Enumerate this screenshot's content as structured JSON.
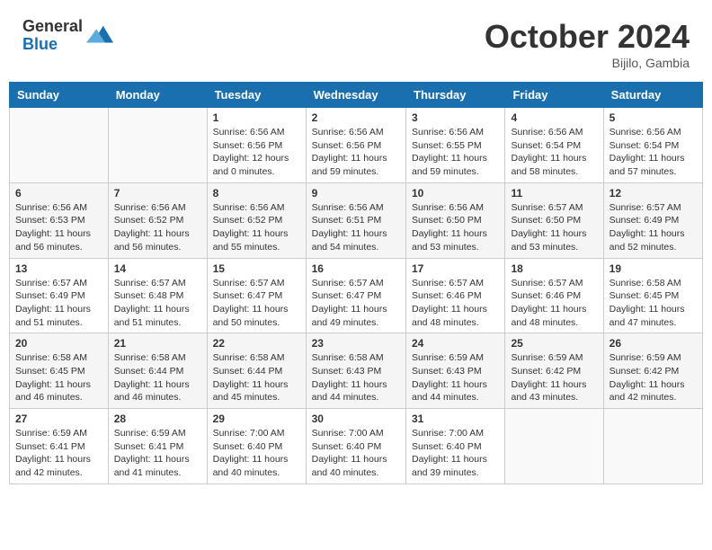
{
  "header": {
    "logo_general": "General",
    "logo_blue": "Blue",
    "month_title": "October 2024",
    "location": "Bijilo, Gambia"
  },
  "days_of_week": [
    "Sunday",
    "Monday",
    "Tuesday",
    "Wednesday",
    "Thursday",
    "Friday",
    "Saturday"
  ],
  "weeks": [
    [
      {
        "day": "",
        "info": ""
      },
      {
        "day": "",
        "info": ""
      },
      {
        "day": "1",
        "sunrise": "Sunrise: 6:56 AM",
        "sunset": "Sunset: 6:56 PM",
        "daylight": "Daylight: 12 hours and 0 minutes."
      },
      {
        "day": "2",
        "sunrise": "Sunrise: 6:56 AM",
        "sunset": "Sunset: 6:56 PM",
        "daylight": "Daylight: 11 hours and 59 minutes."
      },
      {
        "day": "3",
        "sunrise": "Sunrise: 6:56 AM",
        "sunset": "Sunset: 6:55 PM",
        "daylight": "Daylight: 11 hours and 59 minutes."
      },
      {
        "day": "4",
        "sunrise": "Sunrise: 6:56 AM",
        "sunset": "Sunset: 6:54 PM",
        "daylight": "Daylight: 11 hours and 58 minutes."
      },
      {
        "day": "5",
        "sunrise": "Sunrise: 6:56 AM",
        "sunset": "Sunset: 6:54 PM",
        "daylight": "Daylight: 11 hours and 57 minutes."
      }
    ],
    [
      {
        "day": "6",
        "sunrise": "Sunrise: 6:56 AM",
        "sunset": "Sunset: 6:53 PM",
        "daylight": "Daylight: 11 hours and 56 minutes."
      },
      {
        "day": "7",
        "sunrise": "Sunrise: 6:56 AM",
        "sunset": "Sunset: 6:52 PM",
        "daylight": "Daylight: 11 hours and 56 minutes."
      },
      {
        "day": "8",
        "sunrise": "Sunrise: 6:56 AM",
        "sunset": "Sunset: 6:52 PM",
        "daylight": "Daylight: 11 hours and 55 minutes."
      },
      {
        "day": "9",
        "sunrise": "Sunrise: 6:56 AM",
        "sunset": "Sunset: 6:51 PM",
        "daylight": "Daylight: 11 hours and 54 minutes."
      },
      {
        "day": "10",
        "sunrise": "Sunrise: 6:56 AM",
        "sunset": "Sunset: 6:50 PM",
        "daylight": "Daylight: 11 hours and 53 minutes."
      },
      {
        "day": "11",
        "sunrise": "Sunrise: 6:57 AM",
        "sunset": "Sunset: 6:50 PM",
        "daylight": "Daylight: 11 hours and 53 minutes."
      },
      {
        "day": "12",
        "sunrise": "Sunrise: 6:57 AM",
        "sunset": "Sunset: 6:49 PM",
        "daylight": "Daylight: 11 hours and 52 minutes."
      }
    ],
    [
      {
        "day": "13",
        "sunrise": "Sunrise: 6:57 AM",
        "sunset": "Sunset: 6:49 PM",
        "daylight": "Daylight: 11 hours and 51 minutes."
      },
      {
        "day": "14",
        "sunrise": "Sunrise: 6:57 AM",
        "sunset": "Sunset: 6:48 PM",
        "daylight": "Daylight: 11 hours and 51 minutes."
      },
      {
        "day": "15",
        "sunrise": "Sunrise: 6:57 AM",
        "sunset": "Sunset: 6:47 PM",
        "daylight": "Daylight: 11 hours and 50 minutes."
      },
      {
        "day": "16",
        "sunrise": "Sunrise: 6:57 AM",
        "sunset": "Sunset: 6:47 PM",
        "daylight": "Daylight: 11 hours and 49 minutes."
      },
      {
        "day": "17",
        "sunrise": "Sunrise: 6:57 AM",
        "sunset": "Sunset: 6:46 PM",
        "daylight": "Daylight: 11 hours and 48 minutes."
      },
      {
        "day": "18",
        "sunrise": "Sunrise: 6:57 AM",
        "sunset": "Sunset: 6:46 PM",
        "daylight": "Daylight: 11 hours and 48 minutes."
      },
      {
        "day": "19",
        "sunrise": "Sunrise: 6:58 AM",
        "sunset": "Sunset: 6:45 PM",
        "daylight": "Daylight: 11 hours and 47 minutes."
      }
    ],
    [
      {
        "day": "20",
        "sunrise": "Sunrise: 6:58 AM",
        "sunset": "Sunset: 6:45 PM",
        "daylight": "Daylight: 11 hours and 46 minutes."
      },
      {
        "day": "21",
        "sunrise": "Sunrise: 6:58 AM",
        "sunset": "Sunset: 6:44 PM",
        "daylight": "Daylight: 11 hours and 46 minutes."
      },
      {
        "day": "22",
        "sunrise": "Sunrise: 6:58 AM",
        "sunset": "Sunset: 6:44 PM",
        "daylight": "Daylight: 11 hours and 45 minutes."
      },
      {
        "day": "23",
        "sunrise": "Sunrise: 6:58 AM",
        "sunset": "Sunset: 6:43 PM",
        "daylight": "Daylight: 11 hours and 44 minutes."
      },
      {
        "day": "24",
        "sunrise": "Sunrise: 6:59 AM",
        "sunset": "Sunset: 6:43 PM",
        "daylight": "Daylight: 11 hours and 44 minutes."
      },
      {
        "day": "25",
        "sunrise": "Sunrise: 6:59 AM",
        "sunset": "Sunset: 6:42 PM",
        "daylight": "Daylight: 11 hours and 43 minutes."
      },
      {
        "day": "26",
        "sunrise": "Sunrise: 6:59 AM",
        "sunset": "Sunset: 6:42 PM",
        "daylight": "Daylight: 11 hours and 42 minutes."
      }
    ],
    [
      {
        "day": "27",
        "sunrise": "Sunrise: 6:59 AM",
        "sunset": "Sunset: 6:41 PM",
        "daylight": "Daylight: 11 hours and 42 minutes."
      },
      {
        "day": "28",
        "sunrise": "Sunrise: 6:59 AM",
        "sunset": "Sunset: 6:41 PM",
        "daylight": "Daylight: 11 hours and 41 minutes."
      },
      {
        "day": "29",
        "sunrise": "Sunrise: 7:00 AM",
        "sunset": "Sunset: 6:40 PM",
        "daylight": "Daylight: 11 hours and 40 minutes."
      },
      {
        "day": "30",
        "sunrise": "Sunrise: 7:00 AM",
        "sunset": "Sunset: 6:40 PM",
        "daylight": "Daylight: 11 hours and 40 minutes."
      },
      {
        "day": "31",
        "sunrise": "Sunrise: 7:00 AM",
        "sunset": "Sunset: 6:40 PM",
        "daylight": "Daylight: 11 hours and 39 minutes."
      },
      {
        "day": "",
        "info": ""
      },
      {
        "day": "",
        "info": ""
      }
    ]
  ]
}
